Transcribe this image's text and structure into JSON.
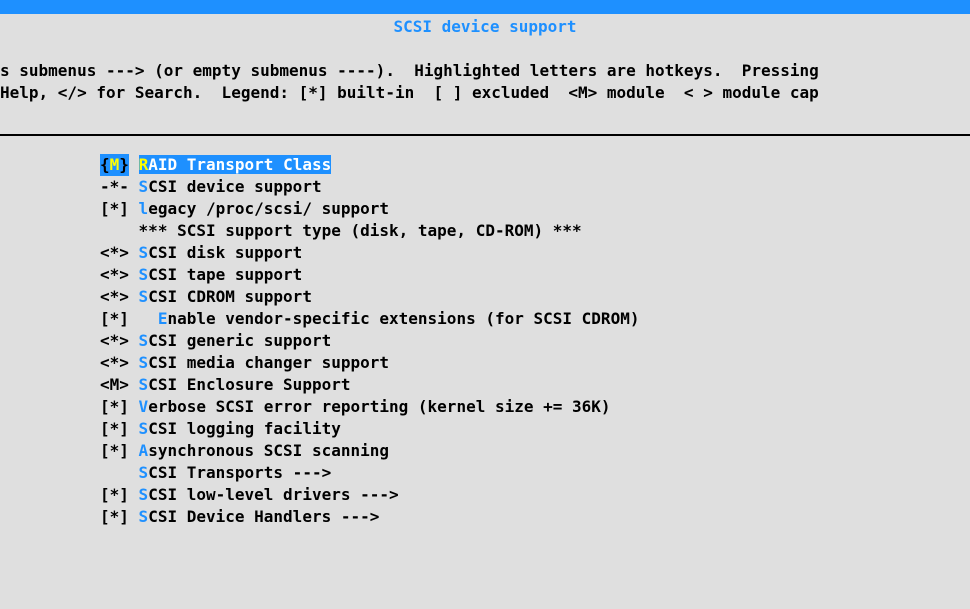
{
  "title": "SCSI device support",
  "help": {
    "line1": "s submenus ---> (or empty submenus ----).  Highlighted letters are hotkeys.  Pressing",
    "line2": "Help, </> for Search.  Legend: [*] built-in  [ ] excluded  <M> module  < > module cap"
  },
  "items": [
    {
      "prefix_open": "{",
      "prefix_inner": "M",
      "prefix_close": "}",
      "lead": " ",
      "hotkey": "R",
      "rest": "AID Transport Class",
      "selected": true
    },
    {
      "prefix": "-*-",
      "lead": " ",
      "hotkey": "S",
      "rest": "CSI device support"
    },
    {
      "prefix": "[*]",
      "lead": " ",
      "hotkey": "l",
      "rest": "egacy /proc/scsi/ support"
    },
    {
      "prefix": "   ",
      "lead": " ",
      "hotkey": "",
      "rest": "*** SCSI support type (disk, tape, CD-ROM) ***",
      "comment": true
    },
    {
      "prefix": "<*>",
      "lead": " ",
      "hotkey": "S",
      "rest": "CSI disk support"
    },
    {
      "prefix": "<*>",
      "lead": " ",
      "hotkey": "S",
      "rest": "CSI tape support"
    },
    {
      "prefix": "<*>",
      "lead": " ",
      "hotkey": "S",
      "rest": "CSI CDROM support"
    },
    {
      "prefix": "[*]",
      "lead": "   ",
      "hotkey": "E",
      "rest": "nable vendor-specific extensions (for SCSI CDROM)"
    },
    {
      "prefix": "<*>",
      "lead": " ",
      "hotkey": "S",
      "rest": "CSI generic support"
    },
    {
      "prefix": "<*>",
      "lead": " ",
      "hotkey": "S",
      "rest": "CSI media changer support"
    },
    {
      "prefix": "<M>",
      "lead": " ",
      "hotkey": "S",
      "rest": "CSI Enclosure Support"
    },
    {
      "prefix": "[*]",
      "lead": " ",
      "hotkey": "V",
      "rest": "erbose SCSI error reporting (kernel size += 36K)"
    },
    {
      "prefix": "[*]",
      "lead": " ",
      "hotkey": "S",
      "rest": "CSI logging facility"
    },
    {
      "prefix": "[*]",
      "lead": " ",
      "hotkey": "A",
      "rest": "synchronous SCSI scanning"
    },
    {
      "prefix": "   ",
      "lead": " ",
      "hotkey": "S",
      "rest": "CSI Transports  --->"
    },
    {
      "prefix": "[*]",
      "lead": " ",
      "hotkey": "S",
      "rest": "CSI low-level drivers  --->"
    },
    {
      "prefix": "[*]",
      "lead": " ",
      "hotkey": "S",
      "rest": "CSI Device Handlers  --->"
    }
  ]
}
